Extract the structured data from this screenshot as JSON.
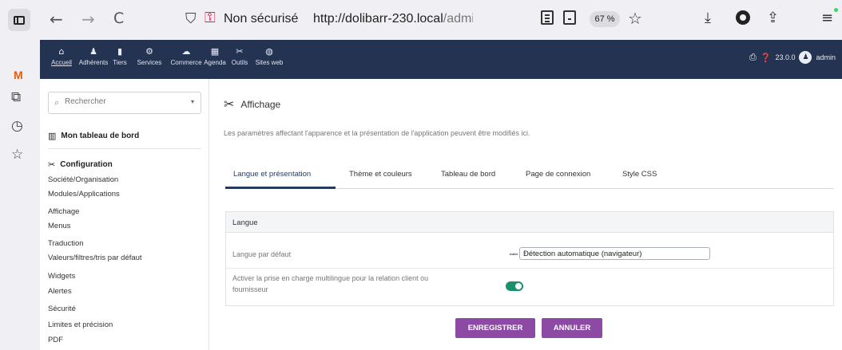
{
  "browser": {
    "nav_back": "←",
    "nav_forward": "→",
    "reload": "C",
    "insecure_label": "Non sécurisé",
    "url_host": "http://dolibarr-230.local",
    "url_path": "/admin/ihm.php?ma",
    "zoom": "67 %"
  },
  "nav": {
    "items": [
      {
        "icon": "⌂",
        "label": "Accueil"
      },
      {
        "icon": "♟",
        "label": "Adhérents"
      },
      {
        "icon": "▮",
        "label": "Tiers"
      },
      {
        "icon": "⚙",
        "label": "Services"
      },
      {
        "icon": "☁",
        "label": "Commerce"
      },
      {
        "icon": "▦",
        "label": "Agenda"
      },
      {
        "icon": "✂",
        "label": "Outils"
      },
      {
        "icon": "◍",
        "label": "Sites web"
      }
    ],
    "version": "23.0.0",
    "user": "admin"
  },
  "left_menu": {
    "search_placeholder": "Rechercher",
    "dashboard_label": "Mon tableau de bord",
    "config_label": "Configuration",
    "links": [
      "Société/Organisation",
      "Modules/Applications",
      "Affichage",
      "Menus",
      "Traduction",
      "Valeurs/filtres/tris par défaut",
      "Widgets",
      "Alertes",
      "Sécurité",
      "Limites et précision",
      "PDF"
    ]
  },
  "main": {
    "title": "Affichage",
    "description": "Les paramètres affectant l'apparence et la présentation de l'application peuvent être modifiés ici.",
    "tabs": [
      {
        "label": "Langue et présentation",
        "active": true
      },
      {
        "label": "Thème et couleurs",
        "active": false
      },
      {
        "label": "Tableau de bord",
        "active": false
      },
      {
        "label": "Page de connexion",
        "active": false
      },
      {
        "label": "Style CSS",
        "active": false
      }
    ],
    "section_title": "Langue",
    "rows": [
      {
        "label": "Langue par défaut",
        "value": "Détection automatique (navigateur)"
      },
      {
        "label_line1": "Activer la prise en charge multilingue pour la relation client ou",
        "label_line2": "fournisseur",
        "toggle_on": true
      }
    ],
    "save_label": "ENREGISTRER",
    "cancel_label": "ANNULER"
  },
  "colors": {
    "nav_bg": "#253352",
    "button_bg": "#8d4aa5",
    "toggle_on": "#1e8f6d",
    "insecure": "#d7264f"
  }
}
